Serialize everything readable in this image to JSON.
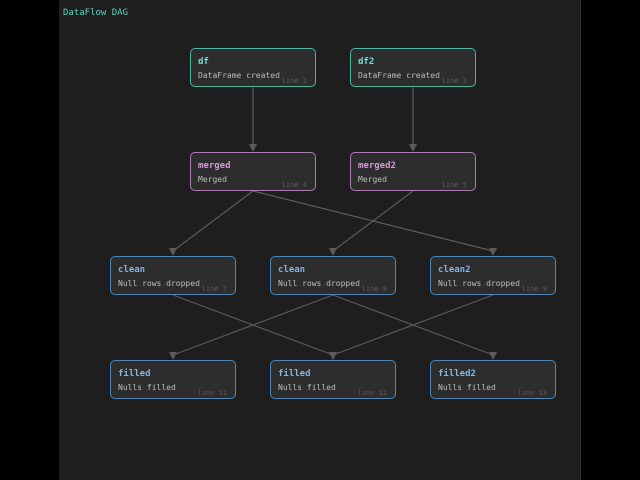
{
  "title": "DataFlow DAG",
  "colors": {
    "background": "#1e1e1e",
    "node_fill": "#2d2d2d",
    "edge": "#5c5c5c",
    "created": "#4db6a4",
    "merged": "#b07ab7",
    "transformed": "#4f87b9"
  },
  "nodes": [
    {
      "name": "df",
      "desc": "DataFrame created",
      "line": "line 1"
    },
    {
      "name": "df2",
      "desc": "DataFrame created",
      "line": "line 2"
    },
    {
      "name": "merged",
      "desc": "Merged",
      "line": "line 4"
    },
    {
      "name": "merged2",
      "desc": "Merged",
      "line": "line 5"
    },
    {
      "name": "clean",
      "desc": "Null rows dropped",
      "line": "line 7"
    },
    {
      "name": "clean",
      "desc": "Null rows dropped",
      "line": "line 8"
    },
    {
      "name": "clean2",
      "desc": "Null rows dropped",
      "line": "line 9"
    },
    {
      "name": "filled",
      "desc": "Nulls filled",
      "line": "line 11"
    },
    {
      "name": "filled",
      "desc": "Nulls filled",
      "line": "line 12"
    },
    {
      "name": "filled2",
      "desc": "Nulls filled",
      "line": "line 13"
    }
  ],
  "edges": [
    {
      "from": 0,
      "to": 2
    },
    {
      "from": 1,
      "to": 3
    },
    {
      "from": 2,
      "to": 4
    },
    {
      "from": 2,
      "to": 6
    },
    {
      "from": 3,
      "to": 5
    },
    {
      "from": 4,
      "to": 8
    },
    {
      "from": 5,
      "to": 7
    },
    {
      "from": 5,
      "to": 9
    },
    {
      "from": 6,
      "to": 8
    }
  ]
}
